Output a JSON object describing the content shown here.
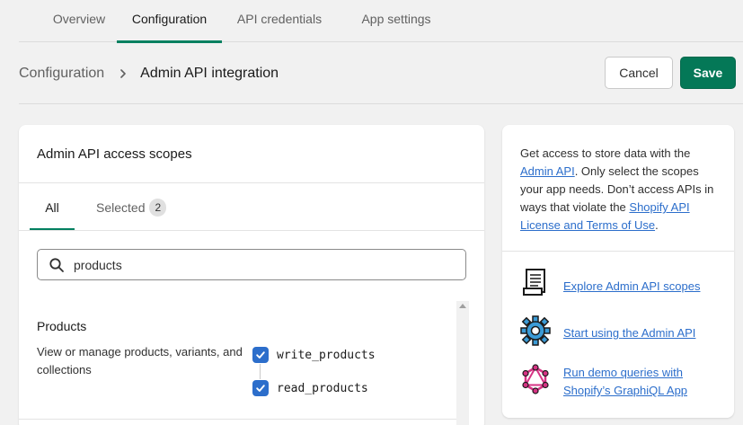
{
  "top_tabs": [
    {
      "label": "Overview"
    },
    {
      "label": "Configuration"
    },
    {
      "label": "API credentials"
    },
    {
      "label": "App settings"
    }
  ],
  "active_top_tab": "Configuration",
  "breadcrumb": {
    "parent": "Configuration",
    "current": "Admin API integration"
  },
  "actions": {
    "cancel_label": "Cancel",
    "save_label": "Save"
  },
  "scopes_card": {
    "title": "Admin API access scopes",
    "tabs": [
      {
        "label": "All"
      },
      {
        "label": "Selected",
        "count": "2"
      }
    ],
    "search": {
      "value": "products",
      "placeholder": ""
    },
    "section": {
      "title": "Products",
      "description": "View or manage products, variants, and collections",
      "permissions": [
        {
          "label": "write_products",
          "checked": true
        },
        {
          "label": "read_products",
          "checked": true
        }
      ]
    }
  },
  "help_card": {
    "text_1": "Get access to store data with the ",
    "link_1": "Admin API",
    "text_2": ". Only select the scopes your app needs. Don’t access APIs in ways that violate the ",
    "link_2": "Shopify API License and Terms of Use",
    "text_3": ".",
    "resources": [
      {
        "label": "Explore Admin API scopes",
        "icon": "scroll-document-icon"
      },
      {
        "label": "Start using the Admin API",
        "icon": "gear-icon"
      },
      {
        "label": "Run demo queries with Shopify’s GraphiQL App",
        "icon": "graphql-icon"
      }
    ]
  },
  "colors": {
    "accent": "#008060",
    "save_button": "#047857",
    "link": "#2c6ecb",
    "checkbox": "#2c6ecb"
  }
}
